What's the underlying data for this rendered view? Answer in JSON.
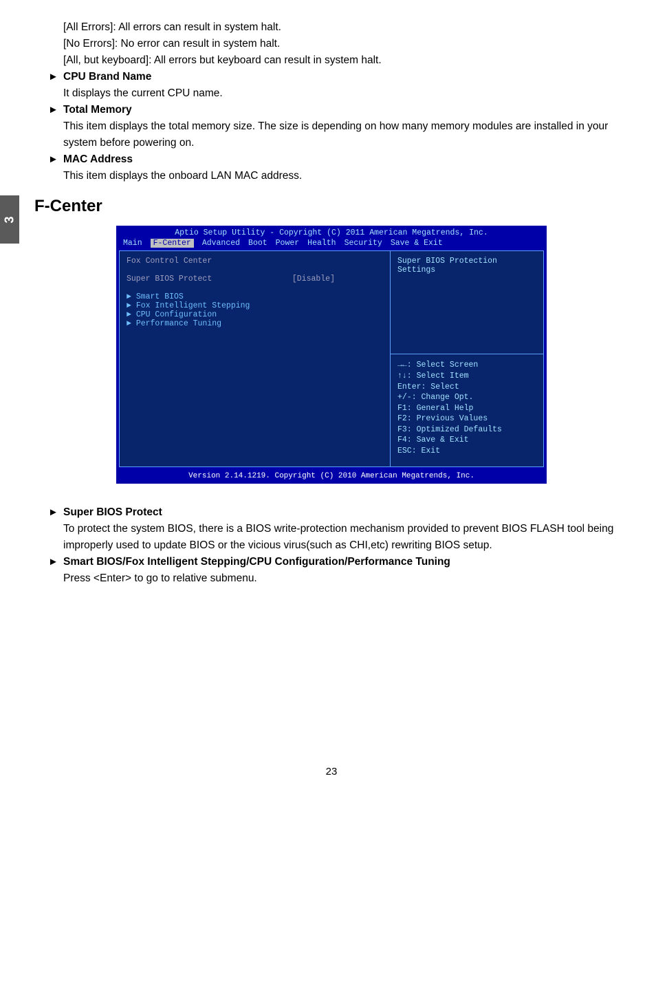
{
  "sideTab": "3",
  "intro": {
    "line1": "[All Errors]: All errors can result in system halt.",
    "line2": "[No Errors]: No error can result in system halt.",
    "line3": "[All, but keyboard]: All errors but keyboard can result in system halt."
  },
  "items": [
    {
      "title": "CPU Brand Name",
      "desc": "It displays the current CPU name."
    },
    {
      "title": "Total Memory",
      "desc": "This item displays the total memory size. The size is depending on how many memory modules are installed in your system before powering on."
    },
    {
      "title": "MAC Address",
      "desc": "This item displays the onboard LAN MAC address."
    }
  ],
  "heading": "F-Center",
  "bios": {
    "title": "Aptio Setup Utility - Copyright (C) 2011 American Megatrends, Inc.",
    "menu": [
      "Main",
      "F-Center",
      "Advanced",
      "Boot",
      "Power",
      "Health",
      "Security",
      "Save & Exit"
    ],
    "activeMenu": "F-Center",
    "leftTitle": "Fox Control Center",
    "option": {
      "name": "Super BIOS Protect",
      "value": "[Disable]"
    },
    "subs": [
      "Smart BIOS",
      "Fox Intelligent Stepping",
      "CPU Configuration",
      "Performance Tuning"
    ],
    "rightTitle": "Super BIOS Protection Settings",
    "help": [
      "→←: Select Screen",
      "↑↓: Select Item",
      "Enter: Select",
      "+/-: Change Opt.",
      "F1: General Help",
      "F2: Previous Values",
      "F3: Optimized Defaults",
      "F4: Save & Exit",
      "ESC: Exit"
    ],
    "footer": "Version 2.14.1219. Copyright (C) 2010 American Megatrends, Inc."
  },
  "below": [
    {
      "title": "Super BIOS Protect",
      "desc": "To protect the system BIOS, there is a BIOS write-protection mechanism provided to prevent BIOS FLASH tool being improperly used to update BIOS or the vicious virus(such as CHI,etc) rewriting BIOS setup."
    },
    {
      "title": "Smart BIOS/Fox Intelligent Stepping/CPU Configuration/Performance Tuning",
      "desc": "Press <Enter> to go to relative submenu."
    }
  ],
  "pageNum": "23"
}
